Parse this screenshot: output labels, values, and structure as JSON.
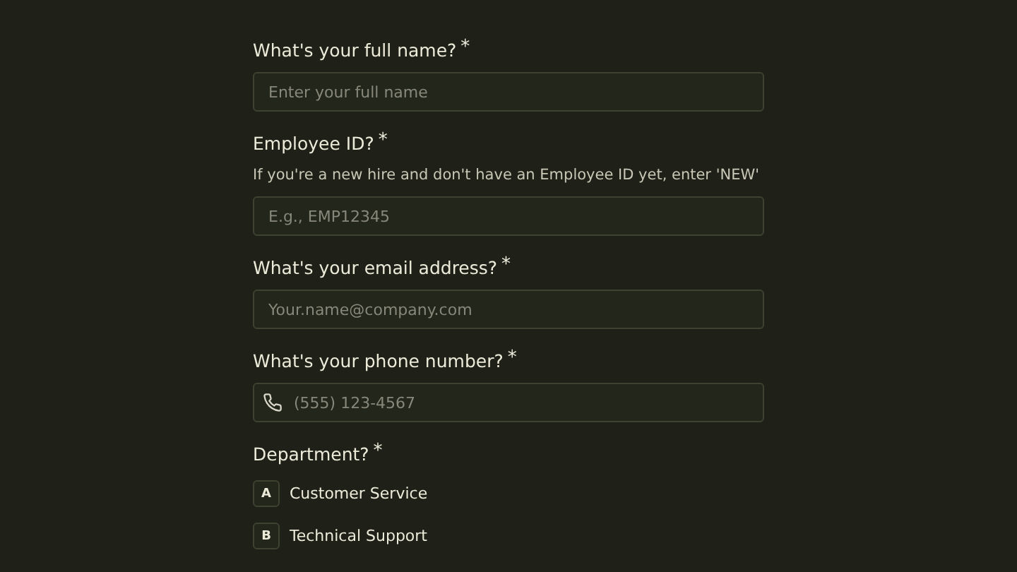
{
  "questions": [
    {
      "kind": "text",
      "label": "What's your full name?",
      "mark": "*",
      "placeholder": "Enter your full name"
    },
    {
      "kind": "text",
      "label": "Employee ID?",
      "mark": "*",
      "hint": "If you're a new hire and don't have an Employee ID yet, enter 'NEW'",
      "placeholder": "E.g., EMP12345"
    },
    {
      "kind": "text",
      "label": "What's your email address?",
      "mark": "*",
      "placeholder": "Your.name@company.com"
    },
    {
      "kind": "phone",
      "label": "What's your phone number?",
      "mark": "*",
      "placeholder": "(555) 123-4567"
    },
    {
      "kind": "choice",
      "label": "Department?",
      "mark": "*",
      "options": [
        {
          "key": "A",
          "label": "Customer Service"
        },
        {
          "key": "B",
          "label": "Technical Support"
        }
      ]
    }
  ]
}
